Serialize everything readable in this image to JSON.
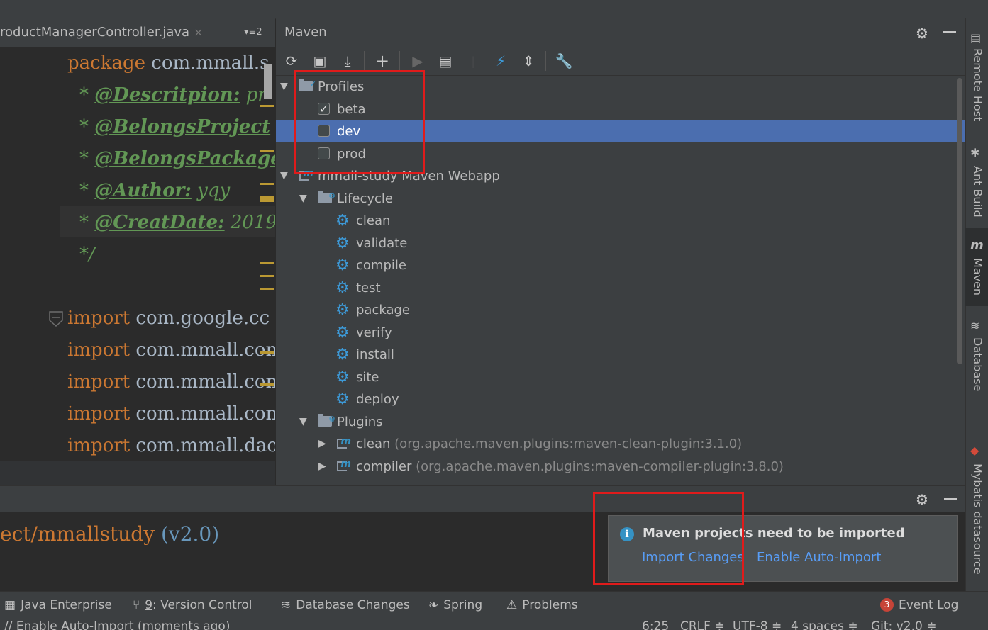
{
  "editor": {
    "tab_title": "roductManagerController.java",
    "tab_close": "×",
    "tab_menu": "▾≡2",
    "lines": {
      "package_kw": "package",
      "package_name": "com.mmall.s",
      "desc_star": "*",
      "desc_tag": "@Descritpion:",
      "desc_val": "pr",
      "proj_star": "*",
      "proj_tag": "@BelongsProject",
      "pkg_star": "*",
      "pkg_tag": "@BelongsPackage",
      "author_star": "*",
      "author_tag": "@Author:",
      "author_val": "yqy",
      "date_star": "*",
      "date_tag": "@CreatDate:",
      "date_val": "2019",
      "close_doc": "*/",
      "imports": [
        {
          "kw": "import",
          "val": "com.google.cc"
        },
        {
          "kw": "import",
          "val": "com.mmall.con"
        },
        {
          "kw": "import",
          "val": "com.mmall.con"
        },
        {
          "kw": "import",
          "val": "com.mmall.con"
        },
        {
          "kw": "import",
          "val": "com.mmall.dao"
        }
      ]
    }
  },
  "maven": {
    "title": "Maven",
    "toolbar_icons": [
      "refresh-icon",
      "reimport-icon",
      "download-icon",
      "add-icon",
      "run-icon",
      "execute-goal-icon",
      "toggle-offline-icon",
      "skip-tests-icon",
      "collapse-all-icon",
      "settings-wrench-icon"
    ],
    "profiles_label": "Profiles",
    "profiles": [
      {
        "name": "beta",
        "checked": true
      },
      {
        "name": "dev",
        "checked": false,
        "selected": true
      },
      {
        "name": "prod",
        "checked": false
      }
    ],
    "project_label": "mmall-study Maven Webapp",
    "lifecycle_label": "Lifecycle",
    "lifecycle": [
      "clean",
      "validate",
      "compile",
      "test",
      "package",
      "verify",
      "install",
      "site",
      "deploy"
    ],
    "plugins_label": "Plugins",
    "plugins": [
      {
        "name": "clean",
        "coord": "(org.apache.maven.plugins:maven-clean-plugin:3.1.0)"
      },
      {
        "name": "compiler",
        "coord": "(org.apache.maven.plugins:maven-compiler-plugin:3.8.0)"
      }
    ]
  },
  "right_stripe": {
    "remote_host": "Remote Host",
    "ant_build": "Ant Build",
    "maven": "Maven",
    "database": "Database",
    "mybatis": "Mybatis datasource"
  },
  "console": {
    "path": "ect/mmallstudy",
    "version": "(v2.0)"
  },
  "notification": {
    "title": "Maven projects need to be imported",
    "import_changes": "Import Changes",
    "enable_auto_import": "Enable Auto-Import"
  },
  "tool_windows": {
    "java_enterprise": "Java Enterprise",
    "version_control_num": "9",
    "version_control": ": Version Control",
    "database_changes": "Database Changes",
    "spring": "Spring",
    "problems": "Problems",
    "event_log_count": "3",
    "event_log": "Event Log"
  },
  "status": {
    "message": "// Enable Auto-Import (moments ago)",
    "position": "6:25",
    "line_sep": "CRLF ≑",
    "encoding": "UTF-8 ≑",
    "indent": "4 spaces ≑",
    "git": "Git: v2.0 ≑"
  },
  "colors": {
    "selection": "#4b6eaf",
    "highlight_box": "#e01b1b",
    "link": "#589df6",
    "keyword": "#cc7832",
    "doc_comment": "#629755"
  }
}
